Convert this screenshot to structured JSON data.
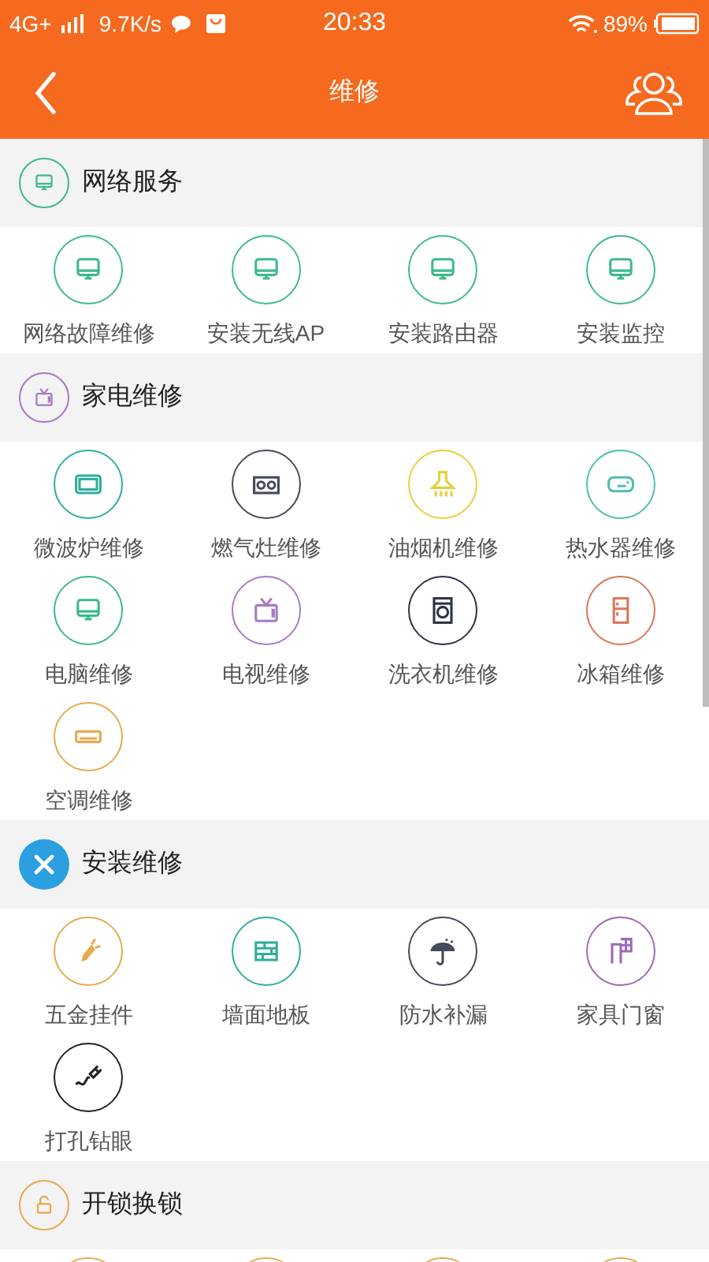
{
  "status_bar": {
    "network": "4G+",
    "speed": "9.7K/s",
    "time": "20:33",
    "battery": "89%"
  },
  "header": {
    "title": "维修"
  },
  "sections": [
    {
      "title": "网络服务",
      "icon": {
        "kind": "monitor",
        "color": "#3dba8a",
        "filled": false
      },
      "items": [
        {
          "label": "网络故障维修",
          "kind": "monitor",
          "color": "#3dba8a"
        },
        {
          "label": "安装无线AP",
          "kind": "monitor",
          "color": "#3dba8a"
        },
        {
          "label": "安装路由器",
          "kind": "monitor",
          "color": "#3dba8a"
        },
        {
          "label": "安装监控",
          "kind": "monitor",
          "color": "#3dba8a"
        }
      ]
    },
    {
      "title": "家电维修",
      "icon": {
        "kind": "tv",
        "color": "#a77bc4",
        "filled": false
      },
      "items": [
        {
          "label": "微波炉维修",
          "kind": "microwave",
          "color": "#2fae9c"
        },
        {
          "label": "燃气灶维修",
          "kind": "stove",
          "color": "#454a5c"
        },
        {
          "label": "油烟机维修",
          "kind": "hood",
          "color": "#e8cf3a"
        },
        {
          "label": "热水器维修",
          "kind": "heater",
          "color": "#4fbfae"
        },
        {
          "label": "电脑维修",
          "kind": "monitor",
          "color": "#3dba8a"
        },
        {
          "label": "电视维修",
          "kind": "tv",
          "color": "#a77bc4"
        },
        {
          "label": "洗衣机维修",
          "kind": "washer",
          "color": "#2e3248"
        },
        {
          "label": "冰箱维修",
          "kind": "fridge",
          "color": "#d9775a"
        },
        {
          "label": "空调维修",
          "kind": "aircon",
          "color": "#e8a94f"
        }
      ]
    },
    {
      "title": "安装维修",
      "icon": {
        "kind": "tools",
        "color": "#2b9fe0",
        "filled": true
      },
      "items": [
        {
          "label": "五金挂件",
          "kind": "hardware",
          "color": "#e8a94f"
        },
        {
          "label": "墙面地板",
          "kind": "wall",
          "color": "#2fae9c"
        },
        {
          "label": "防水补漏",
          "kind": "umbrella",
          "color": "#454a5c"
        },
        {
          "label": "家具门窗",
          "kind": "door",
          "color": "#9a6bb3"
        },
        {
          "label": "打孔钻眼",
          "kind": "plug",
          "color": "#222222"
        }
      ]
    },
    {
      "title": "开锁换锁",
      "icon": {
        "kind": "lock",
        "color": "#e8a94f",
        "filled": false
      },
      "items": [
        {
          "kind": "hidden",
          "color": "#e8a94f"
        },
        {
          "kind": "hidden",
          "color": "#e8a94f"
        },
        {
          "kind": "hidden",
          "color": "#e8a94f"
        },
        {
          "kind": "hidden",
          "color": "#e8a94f"
        }
      ]
    }
  ]
}
